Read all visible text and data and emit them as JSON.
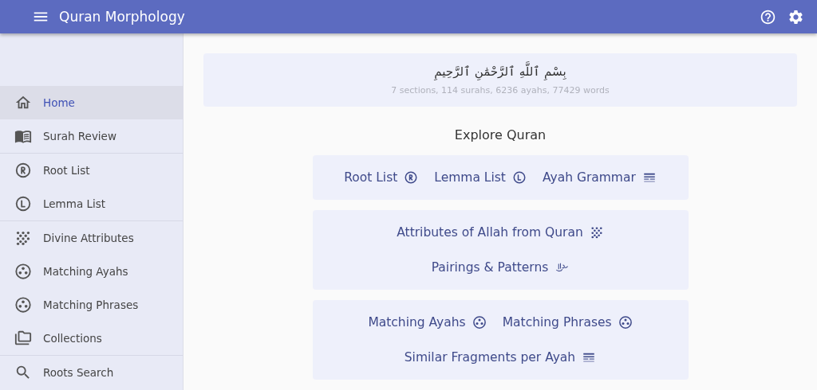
{
  "app_bar": {
    "title": "Quran Morphology"
  },
  "sidebar": {
    "groups": [
      {
        "items": [
          {
            "label": "Home",
            "kind": "home",
            "selected": true
          },
          {
            "label": "Surah Review",
            "kind": "book",
            "selected": false
          }
        ]
      },
      {
        "items": [
          {
            "label": "Root List",
            "kind": "root",
            "selected": false
          },
          {
            "label": "Lemma List",
            "kind": "lemma",
            "selected": false
          }
        ]
      },
      {
        "items": [
          {
            "label": "Divine Attributes",
            "kind": "scatter",
            "selected": false
          },
          {
            "label": "Matching Ayahs",
            "kind": "trio",
            "selected": false
          },
          {
            "label": "Matching Phrases",
            "kind": "trio",
            "selected": false
          },
          {
            "label": "Collections",
            "kind": "folder",
            "selected": false
          }
        ]
      },
      {
        "items": [
          {
            "label": "Roots Search",
            "kind": "search",
            "selected": false
          }
        ]
      }
    ]
  },
  "banner": {
    "basmala": "بِسْمِ ٱللَّهِ ٱلرَّحْمَٰنِ ٱلرَّحِيمِ",
    "stats": "7 sections, 114 surahs, 6236 ayahs, 77429 words"
  },
  "section_title": "Explore Quran",
  "cards": [
    {
      "rows": [
        [
          {
            "label": "Root List",
            "kind": "root"
          },
          {
            "label": "Lemma List",
            "kind": "lemma"
          },
          {
            "label": "Ayah Grammar",
            "kind": "grammar"
          }
        ]
      ]
    },
    {
      "rows": [
        [
          {
            "label": "Attributes of Allah from Quran",
            "kind": "scatter"
          }
        ],
        [
          {
            "label": "Pairings & Patterns",
            "kind": "calligraphy"
          }
        ]
      ]
    },
    {
      "rows": [
        [
          {
            "label": "Matching Ayahs",
            "kind": "trio"
          },
          {
            "label": "Matching Phrases",
            "kind": "trio"
          }
        ],
        [
          {
            "label": "Similar Fragments per Ayah",
            "kind": "grammar"
          }
        ]
      ]
    }
  ]
}
